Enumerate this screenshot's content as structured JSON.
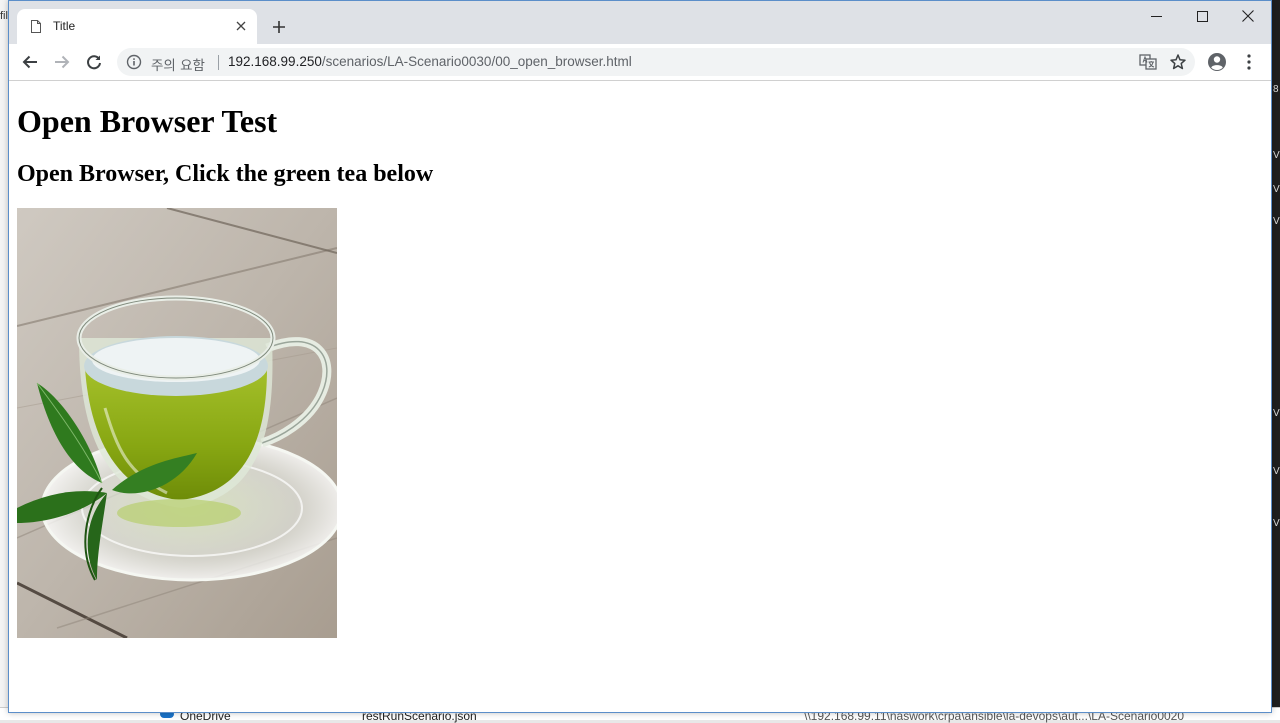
{
  "browser": {
    "tab": {
      "title": "Title"
    },
    "address_bar": {
      "security_label": "주의 요함",
      "url_host": "192.168.99.250",
      "url_path": "/scenarios/LA-Scenario0030/00_open_browser.html"
    }
  },
  "page": {
    "heading": "Open Browser Test",
    "subheading": "Open Browser, Click the green tea below",
    "image": {
      "alt": "green tea",
      "subject": "green tea cup with leaves"
    }
  },
  "background": {
    "left_window_fragment": "fil",
    "taskbar_items": [
      "OneDrive",
      "restRunScenario.json",
      "\\\\192.168.99.11\\naswork\\crpa\\ansible\\la-devops\\aut...\\LA-Scenario0020"
    ]
  },
  "colors": {
    "titlebar": "#dee1e6",
    "omnibox": "#f1f3f4",
    "tea": "#8fb01a",
    "leaf": "#2f7a1e",
    "wood": "#b8b0a6"
  }
}
